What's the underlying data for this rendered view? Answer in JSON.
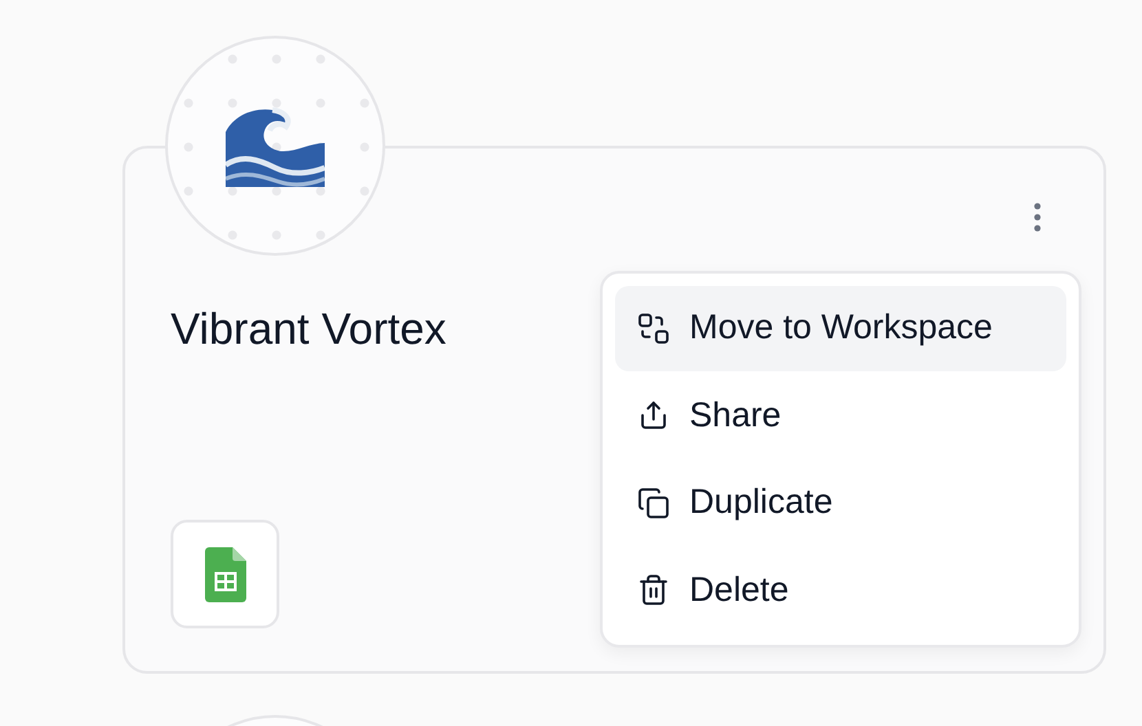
{
  "card": {
    "title": "Vibrant Vortex"
  },
  "menu": {
    "items": [
      {
        "kind": "move",
        "label": "Move to Workspace",
        "selected": true
      },
      {
        "kind": "share",
        "label": "Share",
        "selected": false
      },
      {
        "kind": "duplicate",
        "label": "Duplicate",
        "selected": false
      },
      {
        "kind": "delete",
        "label": "Delete",
        "selected": false
      }
    ]
  }
}
